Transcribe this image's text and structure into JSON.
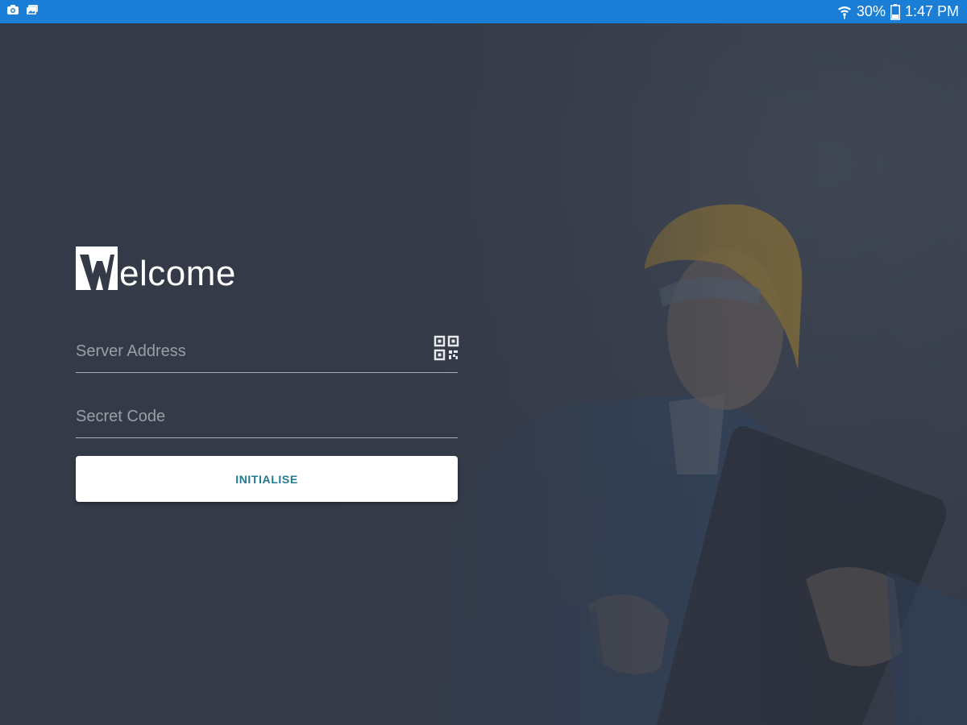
{
  "status_bar": {
    "left_icons": [
      "camera-icon",
      "gallery-icon"
    ],
    "battery_percent": "30%",
    "time": "1:47 PM",
    "right_icons": [
      "wifi-icon",
      "battery-icon"
    ],
    "background_color": "#1b7ed6"
  },
  "login": {
    "logo_text": "elcome",
    "server_address": {
      "placeholder": "Server Address",
      "value": "",
      "action_icon": "qr-code-icon"
    },
    "secret_code": {
      "placeholder": "Secret Code",
      "value": ""
    },
    "initialise_label": "INITIALISE"
  },
  "theme": {
    "background": "#343a47",
    "button_text": "#1f7a93",
    "field_underline": "#a9adb5",
    "placeholder": "#9a9ea7"
  }
}
